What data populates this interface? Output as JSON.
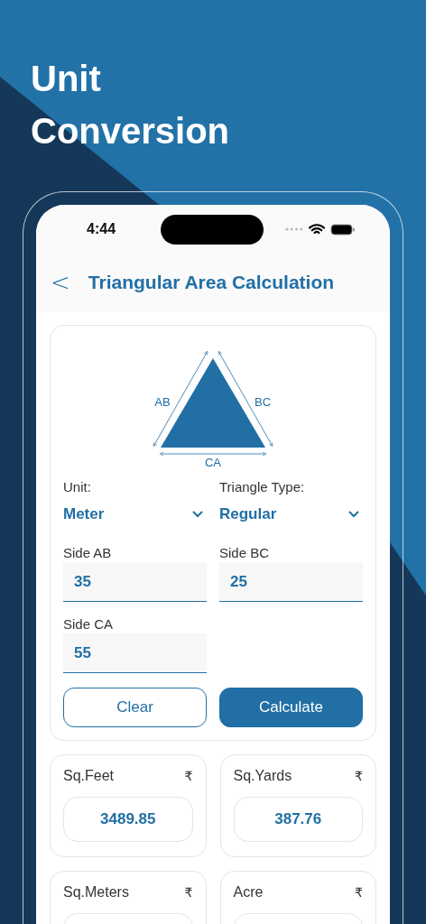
{
  "headline": [
    "Unit",
    "Conversion"
  ],
  "status_bar": {
    "time": "4:44"
  },
  "header": {
    "back": "<",
    "title": "Triangular Area Calculation"
  },
  "diagram": {
    "labels": [
      "AB",
      "BC",
      "CA"
    ]
  },
  "selects": [
    {
      "label": "Unit:",
      "value": "Meter"
    },
    {
      "label": "Triangle Type:",
      "value": "Regular"
    }
  ],
  "sides": [
    {
      "label": "Side AB",
      "value": "35"
    },
    {
      "label": "Side BC",
      "value": "25"
    },
    {
      "label": "Side CA",
      "value": "55"
    }
  ],
  "buttons": [
    {
      "kind": "outline",
      "label": "Clear"
    },
    {
      "kind": "primary",
      "label": "Calculate"
    }
  ],
  "results": [
    {
      "label": "Sq.Feet",
      "currency": "₹",
      "value": "3489.85"
    },
    {
      "label": "Sq.Yards",
      "currency": "₹",
      "value": "387.76"
    },
    {
      "label": "Sq.Meters",
      "currency": "₹"
    },
    {
      "label": "Acre",
      "currency": "₹"
    }
  ]
}
